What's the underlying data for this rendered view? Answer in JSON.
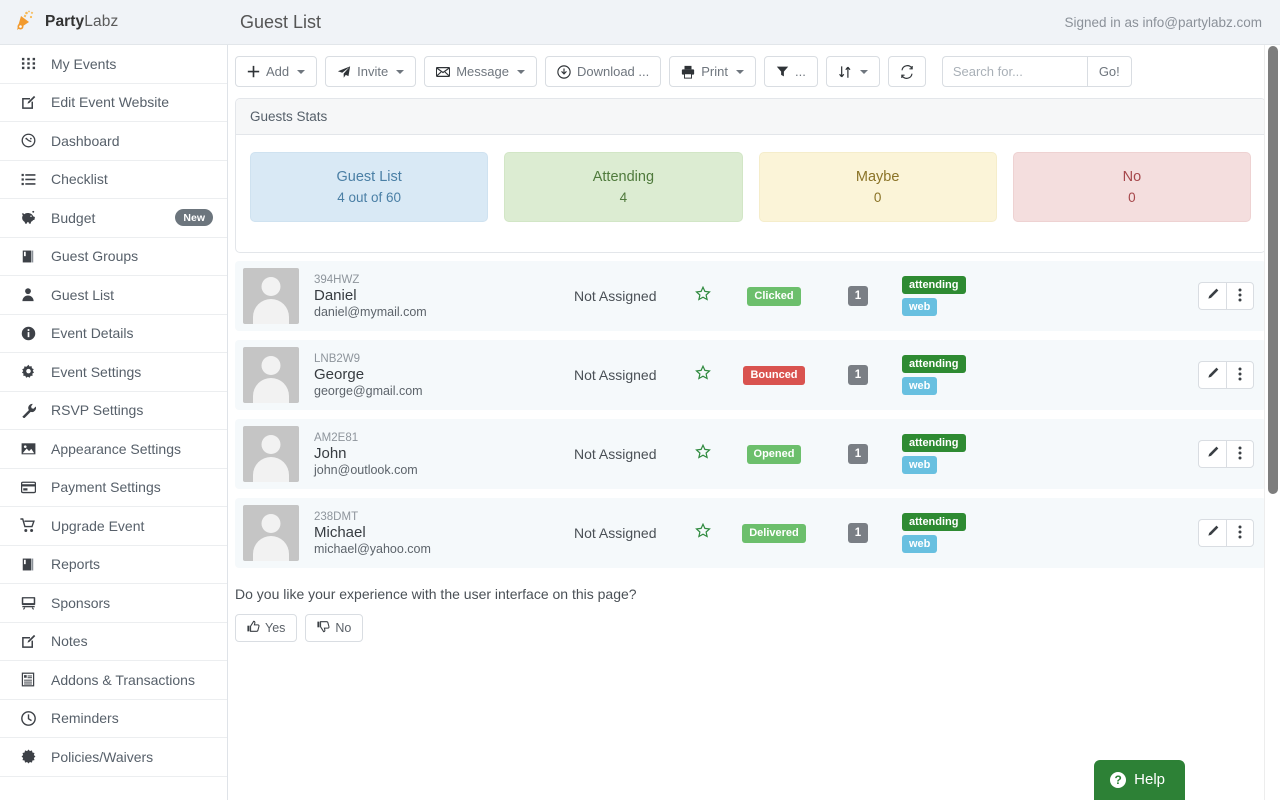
{
  "header": {
    "brand_bold": "Party",
    "brand_light": "Labz",
    "page_title": "Guest List",
    "signed_in": "Signed in as info@partylabz.com"
  },
  "sidebar": {
    "items": [
      {
        "label": "My Events",
        "icon": "grid-icon"
      },
      {
        "label": "Edit Event Website",
        "icon": "pencil-square-icon"
      },
      {
        "label": "Dashboard",
        "icon": "gauge-icon"
      },
      {
        "label": "Checklist",
        "icon": "list-icon"
      },
      {
        "label": "Budget",
        "icon": "piggy-bank-icon",
        "badge": "New"
      },
      {
        "label": "Guest Groups",
        "icon": "book-icon"
      },
      {
        "label": "Guest List",
        "icon": "person-icon"
      },
      {
        "label": "Event Details",
        "icon": "info-circle-icon"
      },
      {
        "label": "Event Settings",
        "icon": "gear-icon"
      },
      {
        "label": "RSVP Settings",
        "icon": "wrench-icon"
      },
      {
        "label": "Appearance Settings",
        "icon": "image-icon"
      },
      {
        "label": "Payment Settings",
        "icon": "credit-card-icon"
      },
      {
        "label": "Upgrade Event",
        "icon": "cart-icon"
      },
      {
        "label": "Reports",
        "icon": "book-icon"
      },
      {
        "label": "Sponsors",
        "icon": "projector-icon"
      },
      {
        "label": "Notes",
        "icon": "pencil-square-icon"
      },
      {
        "label": "Addons & Transactions",
        "icon": "receipt-icon"
      },
      {
        "label": "Reminders",
        "icon": "clock-icon"
      },
      {
        "label": "Policies/Waivers",
        "icon": "seal-icon"
      }
    ]
  },
  "toolbar": {
    "add": "Add",
    "invite": "Invite",
    "message": "Message",
    "download": "Download ...",
    "print": "Print",
    "filter": "...",
    "sort": "",
    "refresh": "",
    "search_placeholder": "Search for...",
    "search_value": "",
    "go": "Go!"
  },
  "stats": {
    "panel_title": "Guests Stats",
    "cards": [
      {
        "title": "Guest List",
        "value": "4 out of 60",
        "color": "blue"
      },
      {
        "title": "Attending",
        "value": "4",
        "color": "green"
      },
      {
        "title": "Maybe",
        "value": "0",
        "color": "yellow"
      },
      {
        "title": "No",
        "value": "0",
        "color": "red"
      }
    ]
  },
  "guests": [
    {
      "code": "394HWZ",
      "name": "Daniel",
      "email": "daniel@mymail.com",
      "assigned": "Not Assigned",
      "tag": "Clicked",
      "tag_color": "g",
      "count": "1",
      "rsvp": "attending",
      "source": "web"
    },
    {
      "code": "LNB2W9",
      "name": "George",
      "email": "george@gmail.com",
      "assigned": "Not Assigned",
      "tag": "Bounced",
      "tag_color": "r",
      "count": "1",
      "rsvp": "attending",
      "source": "web"
    },
    {
      "code": "AM2E81",
      "name": "John",
      "email": "john@outlook.com",
      "assigned": "Not Assigned",
      "tag": "Opened",
      "tag_color": "g",
      "count": "1",
      "rsvp": "attending",
      "source": "web"
    },
    {
      "code": "238DMT",
      "name": "Michael",
      "email": "michael@yahoo.com",
      "assigned": "Not Assigned",
      "tag": "Delivered",
      "tag_color": "g",
      "count": "1",
      "rsvp": "attending",
      "source": "web"
    }
  ],
  "feedback": {
    "question": "Do you like your experience with the user interface on this page?",
    "yes": "Yes",
    "no": "No"
  },
  "help": {
    "label": "Help",
    "glyph": "?"
  },
  "colors": {
    "brand_orange": "#f29a2e",
    "help_green": "#2d8136",
    "attending_green": "#2e8b32",
    "web_blue": "#68c0e0",
    "tag_green": "#6cbf6c",
    "tag_red": "#d9534f"
  }
}
